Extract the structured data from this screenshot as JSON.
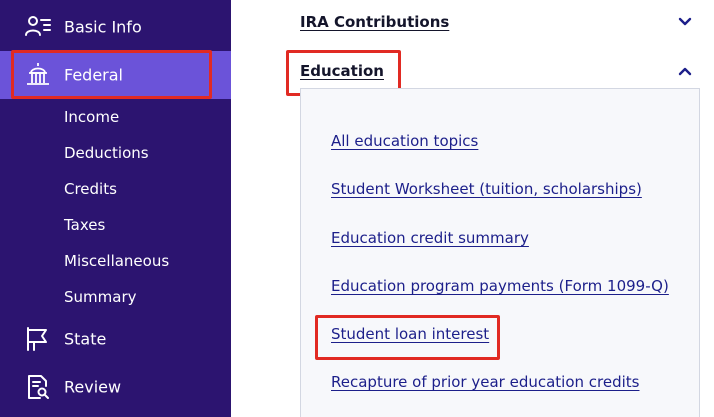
{
  "sidebar": {
    "background": "#2c1470",
    "active_background": "#6b53d9",
    "highlight_color": "#e12a23",
    "items": [
      {
        "label": "Basic Info",
        "icon": "person-list-icon"
      },
      {
        "label": "Federal",
        "icon": "capitol-building-icon",
        "active": true
      },
      {
        "label": "State",
        "icon": "flag-icon"
      },
      {
        "label": "Review",
        "icon": "document-search-icon"
      }
    ],
    "federal_subitems": [
      {
        "label": "Income"
      },
      {
        "label": "Deductions"
      },
      {
        "label": "Credits"
      },
      {
        "label": "Taxes"
      },
      {
        "label": "Miscellaneous"
      },
      {
        "label": "Summary"
      }
    ]
  },
  "main": {
    "sections": [
      {
        "title": "IRA Contributions",
        "expanded": false,
        "chevron": "chevron-down-icon"
      },
      {
        "title": "Education",
        "expanded": true,
        "chevron": "chevron-up-icon"
      }
    ],
    "education_links": [
      {
        "label": "All education topics"
      },
      {
        "label": "Student Worksheet (tuition, scholarships)"
      },
      {
        "label": "Education credit summary"
      },
      {
        "label": "Education program payments (Form 1099-Q)"
      },
      {
        "label": "Student loan interest",
        "highlighted": true
      },
      {
        "label": "Recapture of prior year education credits"
      }
    ]
  }
}
